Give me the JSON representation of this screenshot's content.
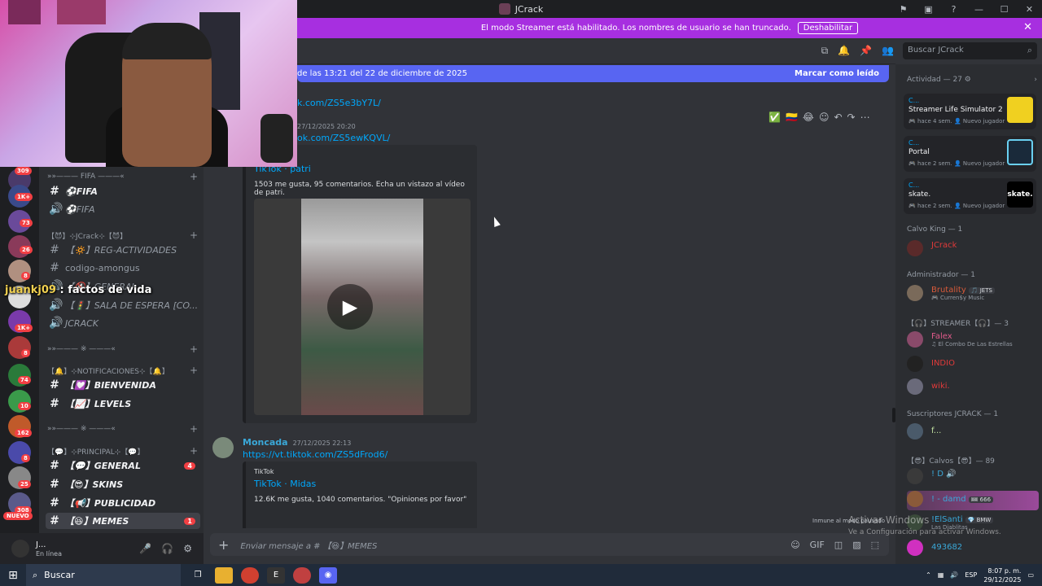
{
  "window": {
    "title": "JCrack"
  },
  "banner": {
    "text": "El modo Streamer está habilitado. Los nombres de usuario se han truncado.",
    "button": "Deshabilitar"
  },
  "overlay": {
    "name": "juankj09",
    "text": " : factos de vida"
  },
  "servers": {
    "badges": [
      "309",
      "1K+",
      "73",
      "26",
      "8",
      "1K+",
      "8",
      "74",
      "10",
      "162",
      "8",
      "25",
      "308"
    ],
    "new_label": "NUEVO"
  },
  "channels": {
    "categories": [
      {
        "label": "»»——— FIFA ———«"
      },
      {
        "label": "【😈】⊹JCrack⊹【😈】"
      },
      {
        "label": "»»——— ※ ———«"
      },
      {
        "label": "【🔔】⊹NOTIFICACIONES⊹【🔔】"
      },
      {
        "label": "»»——— ※ ———«"
      },
      {
        "label": "【💬】⊹PRINCIPAL⊹【💬】"
      }
    ],
    "items": [
      {
        "label": "⚽FIFA",
        "icon": "#"
      },
      {
        "label": "⚽FIFA",
        "icon": "🔊"
      },
      {
        "label": "【🔅】REG-ACTIVIDADES",
        "icon": "#"
      },
      {
        "label": "codigo-amongus",
        "icon": "#"
      },
      {
        "label": "【🔇】GENERAL",
        "icon": "🔊"
      },
      {
        "label": "【🚦】SALA DE ESPERA [CO...",
        "icon": "🔊"
      },
      {
        "label": "JCRACK",
        "icon": "🔊"
      },
      {
        "label": "【💟】BIENVENIDA",
        "icon": "#"
      },
      {
        "label": "【📈】LEVELS",
        "icon": "#"
      },
      {
        "label": "【💬】GENERAL",
        "icon": "#",
        "unread": "4"
      },
      {
        "label": "【😎】SKINS",
        "icon": "#"
      },
      {
        "label": "【📢】PUBLICIDAD",
        "icon": "#"
      },
      {
        "label": "【😆】MEMES",
        "icon": "#",
        "unread": "1"
      }
    ]
  },
  "user": {
    "name": "J...",
    "status": "En línea"
  },
  "newbar": {
    "text": "de las 13:21 del 22 de diciembre de 2025",
    "mark": "Marcar como leído"
  },
  "search": {
    "placeholder": "Buscar JCrack"
  },
  "messages": {
    "link1": "k.com/ZS5e3bY7L/",
    "ts2": "27/12/2025 20:20",
    "link2": "ok.com/ZS5ewKQVL/",
    "embed1": {
      "title": "TikTok · patri",
      "desc": "1503 me gusta, 95 comentarios. Echa un vistazo al vídeo de patri."
    },
    "msg3": {
      "author": "Moncada",
      "ts": "27/12/2025 22:13",
      "link": "https://vt.tiktok.com/ZS5dFrod6/"
    },
    "embed2": {
      "provider": "TikTok",
      "title": "TikTok · Midas",
      "desc": "12.6K me gusta, 1040 comentarios. \"Opiniones por favor\""
    }
  },
  "composer": {
    "placeholder": "Enviar mensaje a # 【😆】MEMES"
  },
  "immune": "Inmune al modo pausado",
  "activate": {
    "line1": "Activar Windows",
    "line2": "Ve a Configuración para activar Windows."
  },
  "rpanel": {
    "activity_head": "Actividad — 27 ⚙",
    "activities": [
      {
        "name": "C...",
        "game": "Streamer Life Simulator 2",
        "meta": "🎮 hace 4 sem.  👤 Nuevo jugador"
      },
      {
        "name": "C...",
        "game": "Portal",
        "meta": "🎮 hace 2 sem.  👤 Nuevo jugador"
      },
      {
        "name": "C...",
        "game": "skate.",
        "meta": "🎮 hace 2 sem.  👤 Nuevo jugador"
      }
    ],
    "skate_label": "skate.",
    "groups": [
      {
        "head": "Calvo King — 1"
      },
      {
        "head": "Administrador — 1"
      },
      {
        "head": "【🎧】STREAMER【🎧】— 3"
      },
      {
        "head": "Suscriptores JCRACK — 1"
      },
      {
        "head": "【😎】Calvos【😎】— 89"
      }
    ],
    "members": [
      {
        "name": "JCrack",
        "color": "#e03a3a",
        "sub": ""
      },
      {
        "name": "Brutality",
        "color": "#d85a3a",
        "sub": "🎮 Curren$y Music",
        "tag": "🎵 JETS"
      },
      {
        "name": "Falex",
        "color": "#e05a8a",
        "sub": "♫ El Combo De Las Estrellas"
      },
      {
        "name": "INDIO",
        "color": "#e03a3a",
        "sub": ""
      },
      {
        "name": "wiki.",
        "color": "#e03a3a",
        "sub": ""
      },
      {
        "name": "f...",
        "color": "#c0e0a0",
        "sub": ""
      },
      {
        "name": "! D 🔊",
        "color": "#3aa8d8",
        "sub": ""
      },
      {
        "name": "! - damd",
        "color": "#3aa8d8",
        "sub": "",
        "tag": "🎟 666"
      },
      {
        "name": "!ElSanti",
        "color": "#3aa8d8",
        "sub": "Las Diablitas",
        "tag": "💎 BMW"
      },
      {
        "name": "493682",
        "color": "#3aa8d8",
        "sub": ""
      }
    ]
  },
  "taskbar": {
    "search": "Buscar",
    "lang": "ESP",
    "time": "8:07 p. m.",
    "date": "29/12/2025"
  }
}
